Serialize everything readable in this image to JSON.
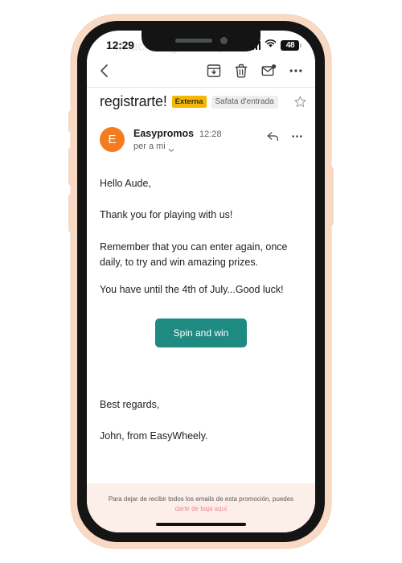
{
  "status_bar": {
    "time": "12:29",
    "signal_icon": "cellular-signal-icon",
    "wifi_icon": "wifi-icon",
    "battery_level": "48"
  },
  "toolbar": {
    "back_icon": "back-chevron-icon",
    "ghost_subject": "¡Muchas gracias por",
    "archive_icon": "archive-icon",
    "delete_icon": "trash-icon",
    "mark_unread_icon": "mark-unread-icon",
    "more_icon": "more-options-icon"
  },
  "subject": {
    "text": "registrarte!",
    "badge": "Externa",
    "folder_label": "Safata d'entrada",
    "star_icon": "star-outline-icon"
  },
  "sender": {
    "avatar_initial": "E",
    "avatar_color": "#f47b20",
    "name": "Easypromos",
    "time": "12:28",
    "recipient": "per a mi",
    "caret_icon": "chevron-down-icon",
    "reply_icon": "reply-arrow-icon",
    "more_icon": "message-more-options-icon"
  },
  "body": {
    "greeting": "Hello Aude,",
    "paragraph_1": "Thank you for playing with us!",
    "paragraph_2": "Remember that you can enter again, once daily, to try and win amazing prizes.",
    "paragraph_3": "You have until the 4th of July...Good luck!",
    "cta_label": "Spin and win",
    "cta_color": "#1f8a82",
    "sign_off": "Best regards,",
    "signature": "John, from EasyWheely."
  },
  "footer": {
    "text": "Para dejar de recibir todos los emails de esta promoción, puedes",
    "link_text": "darte de baja aquí",
    "link_color": "#e98b8b",
    "background_color": "#fceee9"
  },
  "device": {
    "frame_color": "#f7d9c4",
    "bezel_color": "#141414"
  }
}
